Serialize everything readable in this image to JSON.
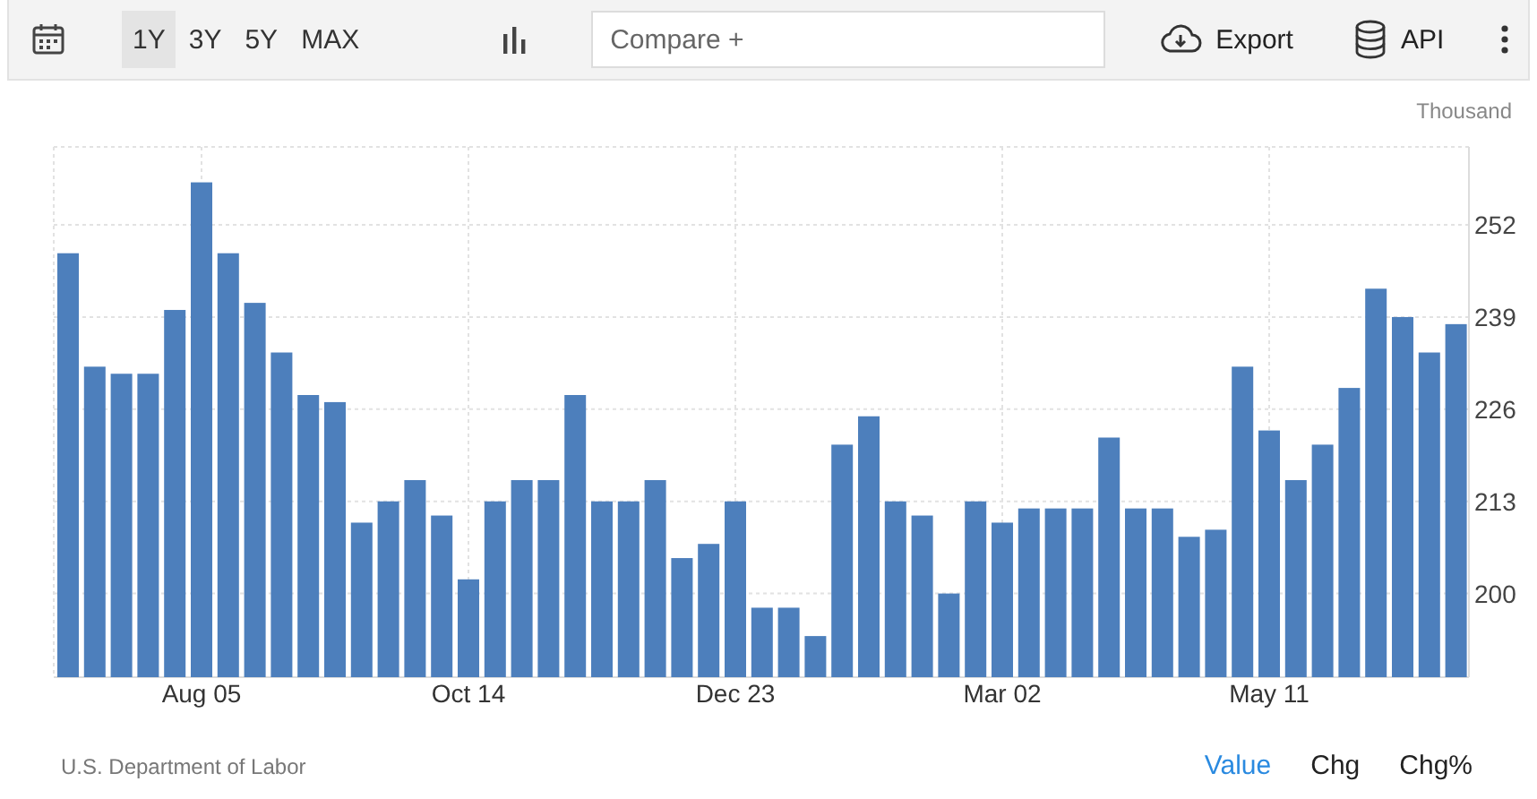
{
  "toolbar": {
    "ranges": [
      {
        "label": "1Y",
        "selected": true
      },
      {
        "label": "3Y",
        "selected": false
      },
      {
        "label": "5Y",
        "selected": false
      },
      {
        "label": "MAX",
        "selected": false
      }
    ],
    "compare": {
      "placeholder": "Compare +"
    },
    "actions": [
      {
        "label": "Export",
        "kind": "export"
      },
      {
        "label": "API",
        "kind": "api"
      }
    ]
  },
  "chart": {
    "chart_data": {
      "type": "bar",
      "ylabel": "Thousand",
      "categories": [
        null,
        null,
        null,
        null,
        null,
        "Aug 05",
        null,
        null,
        null,
        null,
        null,
        null,
        null,
        null,
        null,
        "Oct 14",
        null,
        null,
        null,
        null,
        null,
        null,
        null,
        null,
        null,
        "Dec 23",
        null,
        null,
        null,
        null,
        null,
        null,
        null,
        null,
        null,
        "Mar 02",
        null,
        null,
        null,
        null,
        null,
        null,
        null,
        null,
        null,
        "May 11",
        null,
        null,
        null,
        null,
        null,
        null,
        null
      ],
      "series": [
        {
          "color": "#4d7fbc",
          "values": [
            248,
            232,
            231,
            231,
            240,
            258,
            248,
            241,
            234,
            228,
            227,
            210,
            213,
            216,
            211,
            202,
            213,
            216,
            216,
            228,
            213,
            213,
            216,
            205,
            207,
            213,
            198,
            198,
            194,
            221,
            225,
            213,
            211,
            200,
            213,
            210,
            212,
            212,
            212,
            222,
            212,
            212,
            208,
            209,
            232,
            223,
            216,
            221,
            229,
            243,
            239,
            234,
            238
          ]
        }
      ],
      "ylim": [
        188.2,
        263
      ],
      "yticks": [
        200,
        213,
        226,
        239,
        252
      ],
      "grid": true
    }
  },
  "footer": {
    "source": "U.S. Department of Labor",
    "modes": [
      {
        "label": "Value",
        "selected": true
      },
      {
        "label": "Chg",
        "selected": false
      },
      {
        "label": "Chg%",
        "selected": false
      }
    ]
  }
}
